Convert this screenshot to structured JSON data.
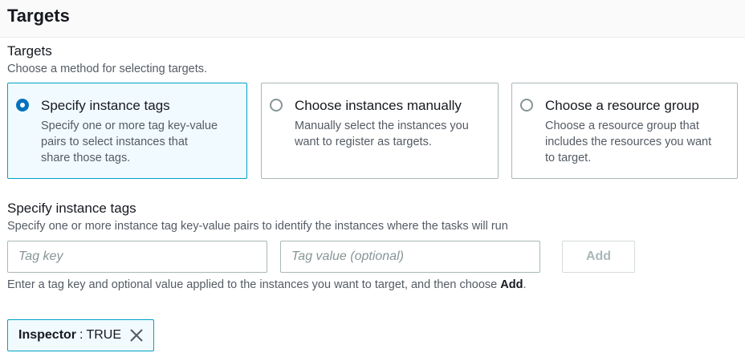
{
  "header": {
    "title": "Targets"
  },
  "targets": {
    "label": "Targets",
    "description": "Choose a method for selecting targets.",
    "options": [
      {
        "title": "Specify instance tags",
        "lines": [
          "Specify one or more tag key-value",
          "pairs to select instances that",
          "share those tags."
        ],
        "selected": true
      },
      {
        "title": "Choose instances manually",
        "lines": [
          "Manually select the instances you",
          "want to register as targets."
        ],
        "selected": false
      },
      {
        "title": "Choose a resource group",
        "lines": [
          "Choose a resource group that",
          "includes the resources you want",
          "to target."
        ],
        "selected": false
      }
    ]
  },
  "tags": {
    "label": "Specify instance tags",
    "description": "Specify one or more instance tag key-value pairs to identify the instances where the tasks will run",
    "key_placeholder": "Tag key",
    "value_placeholder": "Tag value (optional)",
    "add_label": "Add",
    "hint_prefix": "Enter a tag key and optional value applied to the instances you want to target, and then choose ",
    "hint_bold": "Add",
    "hint_suffix": ".",
    "token": {
      "key": "Inspector",
      "separator": ":",
      "value": "TRUE"
    }
  },
  "icons": {
    "remove": "close-icon",
    "radio_selected": "radio-selected",
    "radio_unselected": "radio-unselected"
  },
  "colors": {
    "accent": "#0073bb",
    "selected_border": "#00a1c9",
    "selected_bg": "#f1faff",
    "muted_text": "#545b64"
  }
}
